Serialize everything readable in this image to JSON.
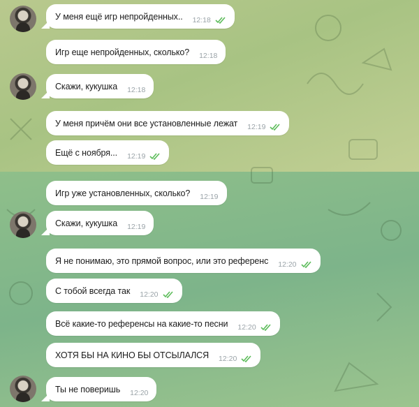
{
  "colors": {
    "check": "#5cbc5a",
    "bubble": "#ffffff",
    "time": "#9aa3a8"
  },
  "messages": [
    {
      "text": "У меня ещё игр непройденных..",
      "time": "12:18",
      "read": true
    },
    {
      "text": "Игр еще непройденных, сколько?",
      "time": "12:18",
      "read": false
    },
    {
      "text": "Скажи, кукушка",
      "time": "12:18",
      "read": false
    },
    {
      "text": "У меня причём они все установленные лежат",
      "time": "12:19",
      "read": true
    },
    {
      "text": "Ещё с ноября...",
      "time": "12:19",
      "read": true
    },
    {
      "text": "Игр уже установленных, сколько?",
      "time": "12:19",
      "read": false
    },
    {
      "text": "Скажи, кукушка",
      "time": "12:19",
      "read": false
    },
    {
      "text": "Я не понимаю, это прямой вопрос, или это референс",
      "time": "12:20",
      "read": true
    },
    {
      "text": "С тобой всегда так",
      "time": "12:20",
      "read": true
    },
    {
      "text": "Всё какие-то референсы на какие-то песни",
      "time": "12:20",
      "read": true
    },
    {
      "text": "ХОТЯ БЫ НА КИНО БЫ ОТСЫЛАЛСЯ",
      "time": "12:20",
      "read": true
    },
    {
      "text": "Ты не поверишь",
      "time": "12:20",
      "read": false
    }
  ]
}
